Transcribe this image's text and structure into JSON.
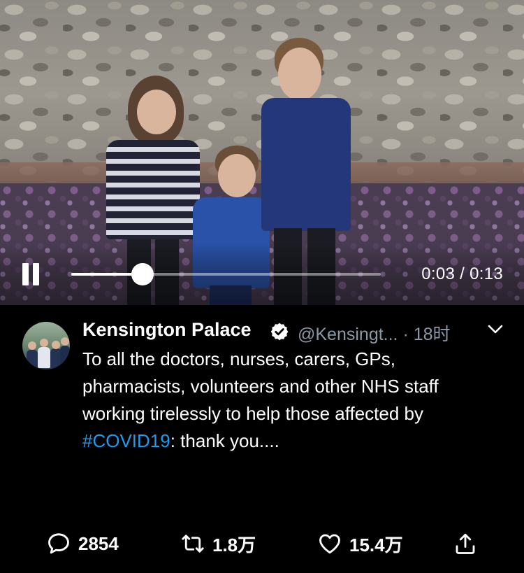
{
  "video": {
    "elapsed": "0:03",
    "duration": "0:13",
    "time_display": "0:03 / 0:13",
    "progress_fraction": 0.23
  },
  "tweet": {
    "display_name": "Kensington Palace",
    "handle": "@Kensingt...",
    "separator": "·",
    "time_ago": "18时",
    "text_before": "To all the doctors, nurses, carers, GPs, pharmacists, volunteers and other NHS staff working tirelessly to help those affected by ",
    "hashtag": "#COVID19",
    "text_after": ": thank you....",
    "verified": true
  },
  "actions": {
    "reply_count": "2854",
    "retweet_count": "1.8万",
    "like_count": "15.4万"
  },
  "icons": {
    "pause": "pause-icon",
    "verified": "verified-badge-icon",
    "chevron": "chevron-down-icon",
    "reply": "reply-icon",
    "retweet": "retweet-icon",
    "like": "heart-icon",
    "share": "share-icon"
  },
  "colors": {
    "background": "#000000",
    "link": "#1d9bf0",
    "secondary_text": "#8b98a5"
  }
}
